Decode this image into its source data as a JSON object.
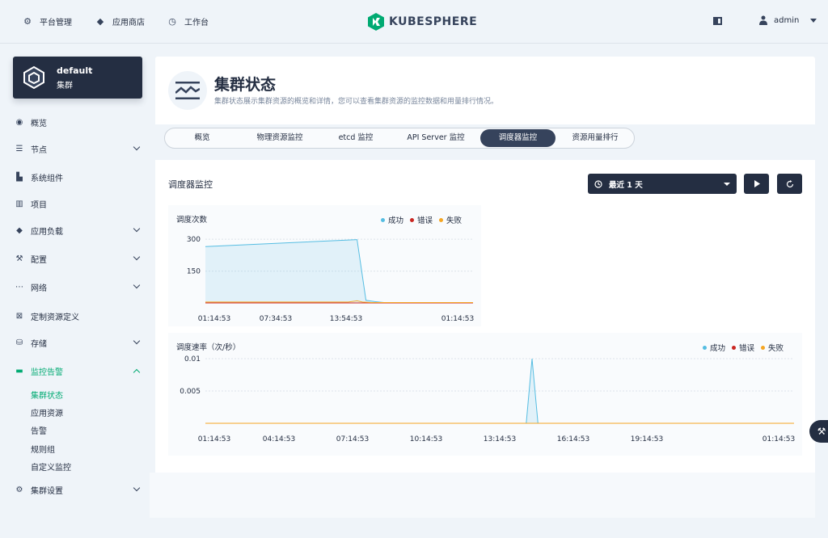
{
  "topnav": {
    "items": [
      {
        "label": "平台管理",
        "icon": "gear-icon"
      },
      {
        "label": "应用商店",
        "icon": "cube-icon"
      },
      {
        "label": "工作台",
        "icon": "clock-icon"
      }
    ],
    "logo_text": "KUBESPHERE",
    "user": "admin"
  },
  "sidebar": {
    "cluster_name": "default",
    "cluster_label": "集群",
    "items": [
      {
        "label": "概览",
        "icon": "overview-icon"
      },
      {
        "label": "节点",
        "icon": "nodes-icon",
        "expandable": true
      },
      {
        "label": "系统组件",
        "icon": "components-icon"
      },
      {
        "label": "项目",
        "icon": "project-icon"
      },
      {
        "label": "应用负载",
        "icon": "workload-icon",
        "expandable": true
      },
      {
        "label": "配置",
        "icon": "wrench-icon",
        "expandable": true
      },
      {
        "label": "网络",
        "icon": "network-icon",
        "expandable": true
      },
      {
        "label": "定制资源定义",
        "icon": "crd-icon"
      },
      {
        "label": "存储",
        "icon": "storage-icon",
        "expandable": true
      },
      {
        "label": "监控告警",
        "icon": "monitor-icon",
        "expandable": true,
        "active": true
      },
      {
        "label": "集群设置",
        "icon": "settings-icon",
        "expandable": true
      }
    ],
    "sub_items": [
      "集群状态",
      "应用资源",
      "告警",
      "规则组",
      "自定义监控"
    ]
  },
  "header": {
    "title": "集群状态",
    "description": "集群状态展示集群资源的概览和详情，您可以查看集群资源的监控数据和用量排行情况。"
  },
  "tabs": [
    "概览",
    "物理资源监控",
    "etcd 监控",
    "API Server 监控",
    "调度器监控",
    "资源用量排行"
  ],
  "active_tab": 4,
  "monitor": {
    "title": "调度器监控",
    "time_range": "最近 1 天"
  },
  "legend": {
    "success": "成功",
    "error": "错误",
    "fail": "失败"
  },
  "colors": {
    "success": "#55bde2",
    "error": "#ca2621",
    "fail": "#f5a623",
    "accent": "#00aa72",
    "dark": "#242e42"
  },
  "chart_data": [
    {
      "type": "area",
      "title": "调度次数",
      "x_ticks": [
        "01:14:53",
        "07:34:53",
        "13:54:53",
        "01:14:53"
      ],
      "y_ticks": [
        "300",
        "150"
      ],
      "ylim": [
        0,
        350
      ],
      "series": [
        {
          "name": "成功",
          "x": [
            0,
            0.84,
            0.85,
            0.9,
            0.95,
            1.0,
            1.5
          ],
          "values": [
            265,
            298,
            298,
            12,
            6,
            2,
            2
          ]
        },
        {
          "name": "错误",
          "x": [
            0,
            1.5
          ],
          "values": [
            0,
            0
          ]
        },
        {
          "name": "失败",
          "x": [
            0,
            0.8,
            0.85,
            0.88,
            0.93,
            1.5
          ],
          "values": [
            4,
            4,
            10,
            4,
            2,
            2
          ]
        }
      ]
    },
    {
      "type": "area",
      "title": "调度速率（次/秒）",
      "x_ticks": [
        "01:14:53",
        "04:14:53",
        "07:14:53",
        "10:14:53",
        "13:14:53",
        "16:14:53",
        "19:14:53",
        "01:14:53"
      ],
      "y_ticks": [
        "0.01",
        "0.005"
      ],
      "ylim": [
        0,
        0.01
      ],
      "series": [
        {
          "name": "成功",
          "x": [
            0,
            0.545,
            0.555,
            0.565,
            1.0
          ],
          "values": [
            0,
            0,
            0.01,
            0,
            0
          ]
        },
        {
          "name": "错误",
          "x": [
            0,
            1.0
          ],
          "values": [
            0,
            0
          ]
        },
        {
          "name": "失败",
          "x": [
            0,
            1.0
          ],
          "values": [
            0,
            0
          ]
        }
      ]
    }
  ]
}
